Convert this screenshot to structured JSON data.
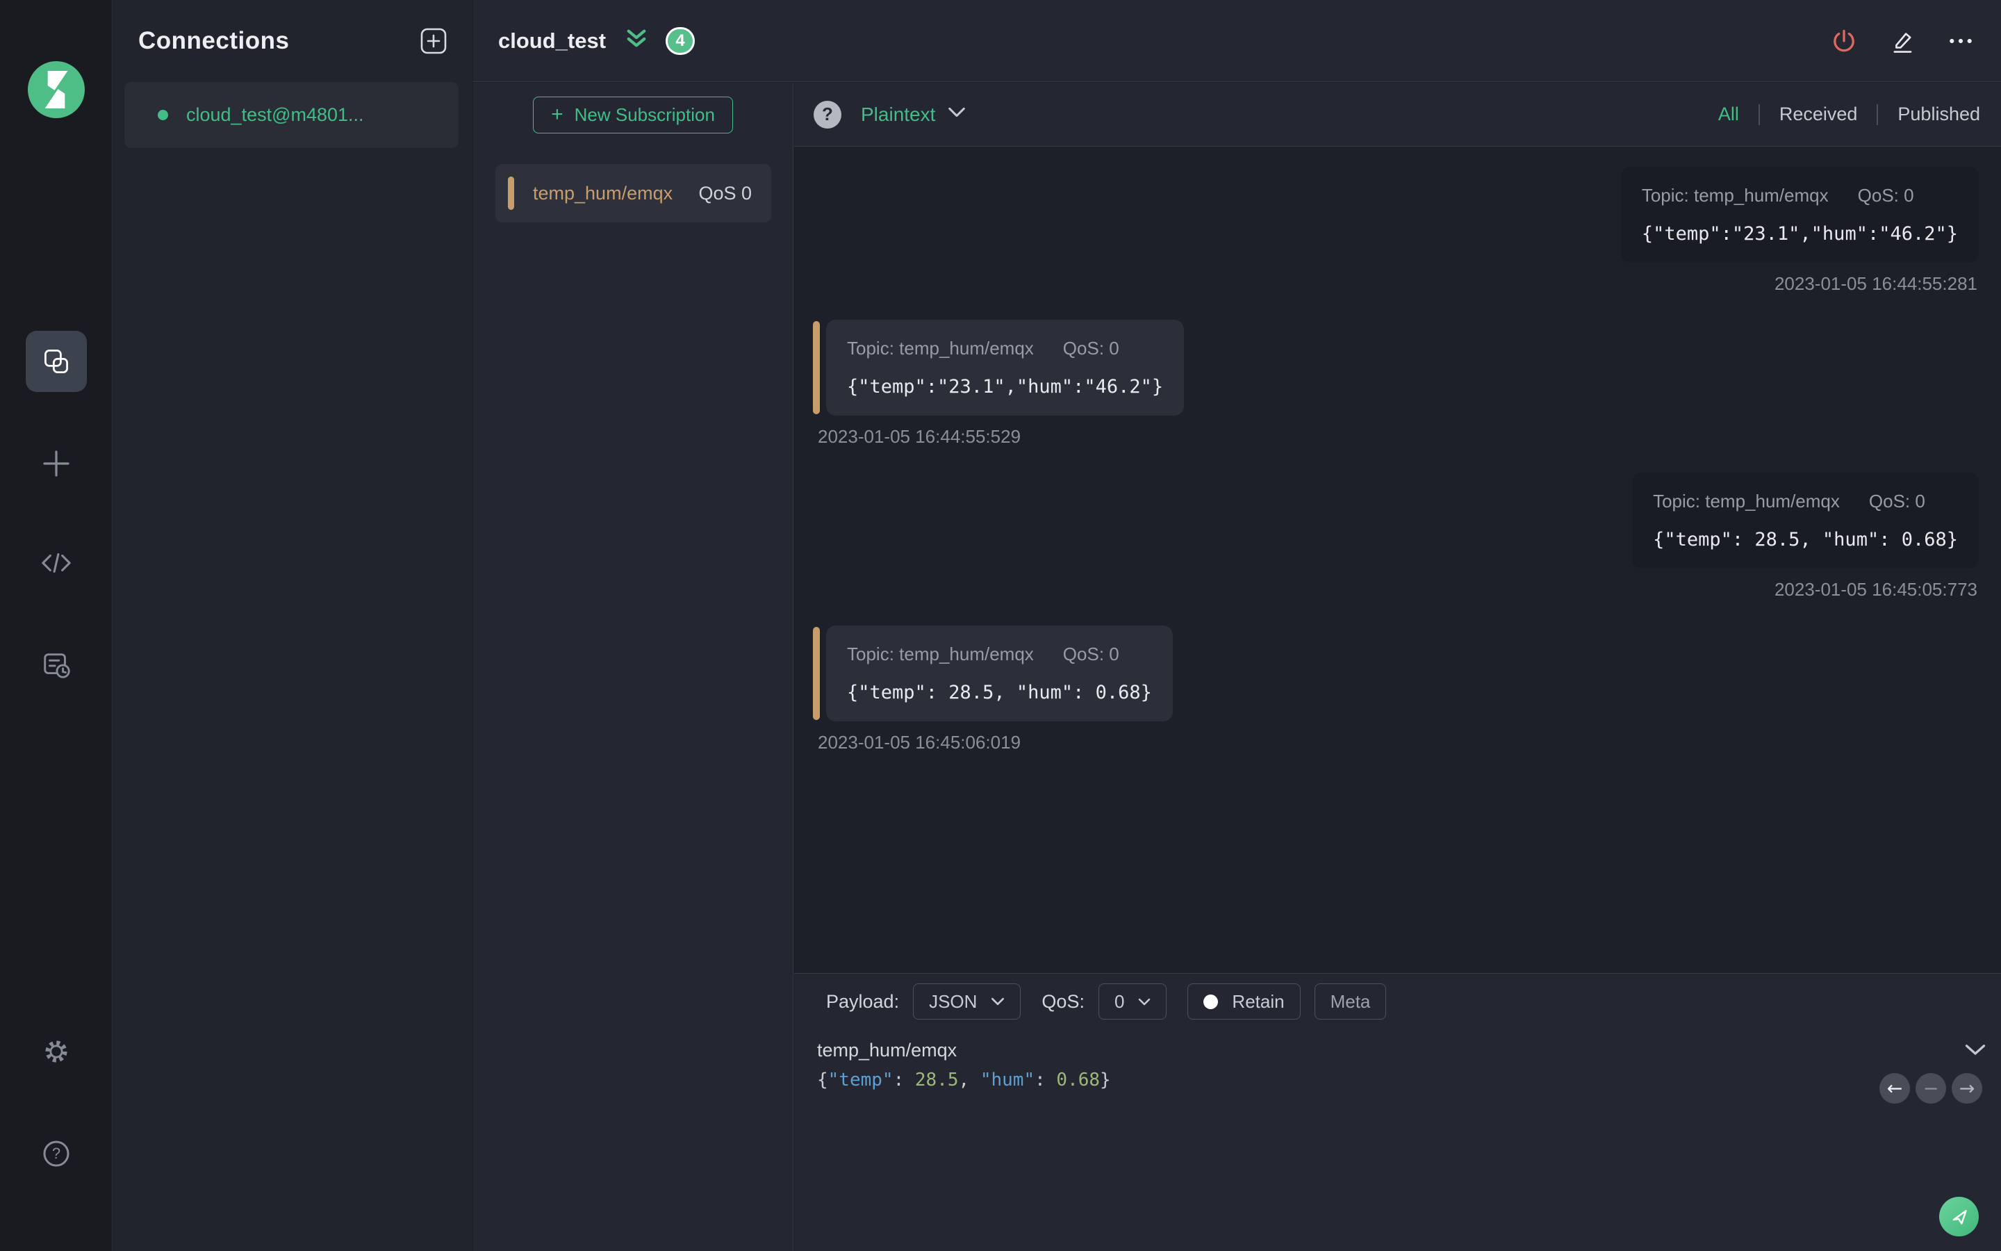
{
  "connections_panel": {
    "title": "Connections",
    "items": [
      {
        "label": "cloud_test@m4801...",
        "status": "connected"
      }
    ]
  },
  "header": {
    "connection_title": "cloud_test",
    "unread_badge": "4"
  },
  "subscriptions": {
    "new_button_label": "New Subscription",
    "items": [
      {
        "topic": "temp_hum/emqx",
        "qos_label": "QoS 0"
      }
    ]
  },
  "messages": {
    "help_glyph": "?",
    "format_selector_value": "Plaintext",
    "filters": [
      {
        "label": "All",
        "active": true
      },
      {
        "label": "Received",
        "active": false
      },
      {
        "label": "Published",
        "active": false
      }
    ],
    "list": [
      {
        "direction": "published",
        "topic_label": "Topic: temp_hum/emqx",
        "qos_label": "QoS: 0",
        "payload": "{\"temp\":\"23.1\",\"hum\":\"46.2\"}",
        "timestamp": "2023-01-05 16:44:55:281"
      },
      {
        "direction": "received",
        "topic_label": "Topic: temp_hum/emqx",
        "qos_label": "QoS: 0",
        "payload": "{\"temp\":\"23.1\",\"hum\":\"46.2\"}",
        "timestamp": "2023-01-05 16:44:55:529"
      },
      {
        "direction": "published",
        "topic_label": "Topic: temp_hum/emqx",
        "qos_label": "QoS: 0",
        "payload": "{\"temp\": 28.5, \"hum\": 0.68}",
        "timestamp": "2023-01-05 16:45:05:773"
      },
      {
        "direction": "received",
        "topic_label": "Topic: temp_hum/emqx",
        "qos_label": "QoS: 0",
        "payload": "{\"temp\": 28.5, \"hum\": 0.68}",
        "timestamp": "2023-01-05 16:45:06:019"
      }
    ]
  },
  "publish": {
    "payload_label": "Payload:",
    "payload_format_value": "JSON",
    "qos_label": "QoS:",
    "qos_value": "0",
    "retain_label": "Retain",
    "meta_label": "Meta",
    "topic_value": "temp_hum/emqx",
    "editor_tokens": [
      {
        "text": "{",
        "type": "punct"
      },
      {
        "text": "\"temp\"",
        "type": "key"
      },
      {
        "text": ": ",
        "type": "punct"
      },
      {
        "text": "28.5",
        "type": "num"
      },
      {
        "text": ", ",
        "type": "punct"
      },
      {
        "text": "\"hum\"",
        "type": "key"
      },
      {
        "text": ": ",
        "type": "punct"
      },
      {
        "text": "0.68",
        "type": "num"
      },
      {
        "text": "}",
        "type": "punct"
      }
    ],
    "nav": {
      "prev_glyph": "←",
      "collapse_glyph": "−",
      "next_glyph": "→"
    }
  },
  "icons": {
    "brand": "mqttx-logo",
    "sidebar": [
      "connections-icon",
      "new-connection-plus-icon",
      "script-icon",
      "log-icon",
      "settings-gear-icon",
      "help-icon"
    ],
    "header_actions": [
      "disconnect-power-icon",
      "edit-pencil-icon",
      "more-ellipsis-icon"
    ],
    "send": "send-plane-icon"
  },
  "colors": {
    "accent_green": "#42bd87",
    "badge_green": "#56bf8b",
    "topic_tan": "#c79e6b",
    "disconnect_coral": "#e0695f",
    "list_bg": "#1d2028",
    "panel_bg": "#242731",
    "received_bubble": "#2b2f3a",
    "published_bubble": "#191c23",
    "json_key_blue": "#5ca0d3",
    "json_num_green": "#9ab97a"
  }
}
